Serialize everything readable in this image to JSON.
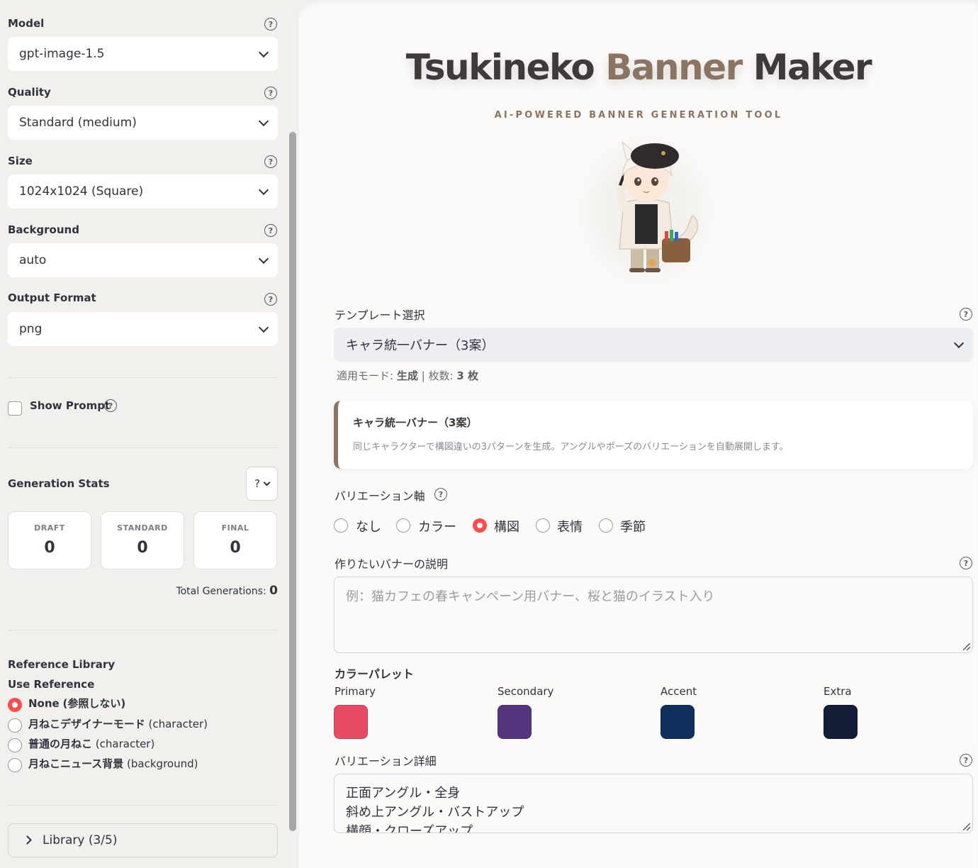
{
  "sidebar": {
    "model": {
      "label": "Model",
      "value": "gpt-image-1.5"
    },
    "quality": {
      "label": "Quality",
      "value": "Standard (medium)"
    },
    "size": {
      "label": "Size",
      "value": "1024x1024 (Square)"
    },
    "background": {
      "label": "Background",
      "value": "auto"
    },
    "output_format": {
      "label": "Output Format",
      "value": "png"
    },
    "show_prompt": {
      "label": "Show Prompt",
      "checked": false
    },
    "stats": {
      "title": "Generation Stats",
      "button_label": "?",
      "cards": [
        {
          "label": "DRAFT",
          "value": "0"
        },
        {
          "label": "STANDARD",
          "value": "0"
        },
        {
          "label": "FINAL",
          "value": "0"
        }
      ],
      "total_label": "Total Generations:",
      "total_value": "0"
    },
    "reference": {
      "title": "Reference Library",
      "use_label": "Use Reference",
      "options": [
        {
          "name": "None",
          "tag": "(参照しない)",
          "selected": true
        },
        {
          "name": "月ねこデザイナーモード",
          "tag": "(character)",
          "selected": false
        },
        {
          "name": "普通の月ねこ",
          "tag": "(character)",
          "selected": false
        },
        {
          "name": "月ねこニュース背景",
          "tag": "(background)",
          "selected": false
        }
      ]
    },
    "library": {
      "label": "Library (3/5)"
    },
    "help_glyph": "?"
  },
  "main": {
    "title_part1": "Tsukineko",
    "title_part2": "Banner",
    "title_part3": "Maker",
    "subtitle": "AI-POWERED BANNER GENERATION TOOL",
    "template": {
      "label": "テンプレート選択",
      "value": "キャラ統一バナー（3案）"
    },
    "meta": {
      "mode_label": "適用モード:",
      "mode_value": "生成",
      "sep": "|",
      "count_label": "枚数:",
      "count_value": "3 枚"
    },
    "card": {
      "title": "キャラ統一バナー（3案）",
      "desc": "同じキャラクターで構図違いの3パターンを生成。アングルやポーズのバリエーションを自動展開します。"
    },
    "variation_axis": {
      "label": "バリエーション軸",
      "options": [
        {
          "label": "なし",
          "selected": false
        },
        {
          "label": "カラー",
          "selected": false
        },
        {
          "label": "構図",
          "selected": true
        },
        {
          "label": "表情",
          "selected": false
        },
        {
          "label": "季節",
          "selected": false
        }
      ]
    },
    "description": {
      "label": "作りたいバナーの説明",
      "placeholder": "例：猫カフェの春キャンペーン用バナー、桜と猫のイラスト入り"
    },
    "palette": {
      "label": "カラーパレット",
      "colors": [
        {
          "name": "Primary",
          "hex": "#e84a63"
        },
        {
          "name": "Secondary",
          "hex": "#55347e"
        },
        {
          "name": "Accent",
          "hex": "#0f2f5c"
        },
        {
          "name": "Extra",
          "hex": "#141d38"
        }
      ]
    },
    "variation_detail": {
      "label": "バリエーション詳細",
      "lines": [
        "正面アングル・全身",
        "斜め上アングル・バストアップ",
        "横顔・クローズアップ"
      ]
    }
  }
}
